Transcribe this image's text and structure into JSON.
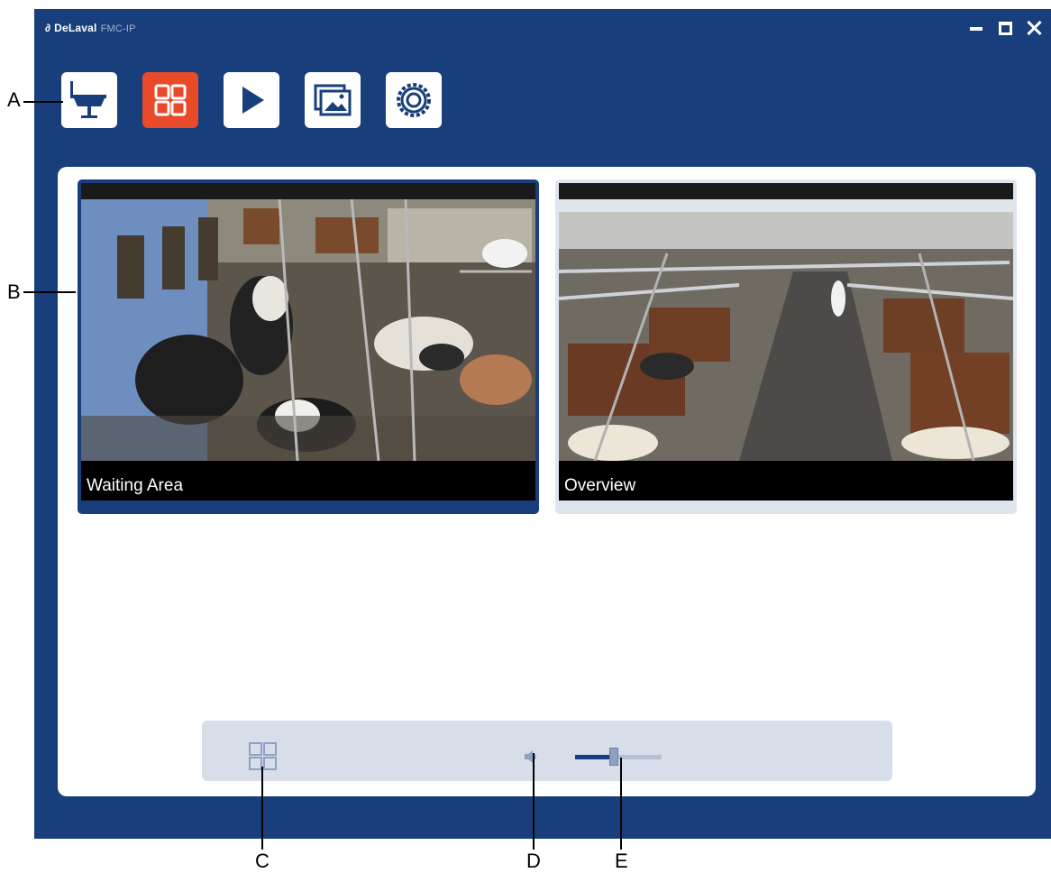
{
  "window": {
    "logo": "∂",
    "brand": "DeLaval",
    "product": "FMC-IP"
  },
  "toolbar": {
    "items": [
      {
        "name": "milking-station",
        "active": false
      },
      {
        "name": "multi-view",
        "active": true
      },
      {
        "name": "playback",
        "active": false
      },
      {
        "name": "snapshots",
        "active": false
      },
      {
        "name": "settings",
        "active": false
      }
    ]
  },
  "cameras": [
    {
      "label": "Waiting Area",
      "selected": true
    },
    {
      "label": "Overview",
      "selected": false
    }
  ],
  "controls": {
    "volume_level": 0.45
  },
  "callouts": {
    "a": "A",
    "b": "B",
    "c": "C",
    "d": "D",
    "e": "E"
  },
  "colors": {
    "window": "#183f7c",
    "active_tool": "#e84a2a",
    "panel": "#ffffff",
    "control_bar": "#d7deea"
  }
}
